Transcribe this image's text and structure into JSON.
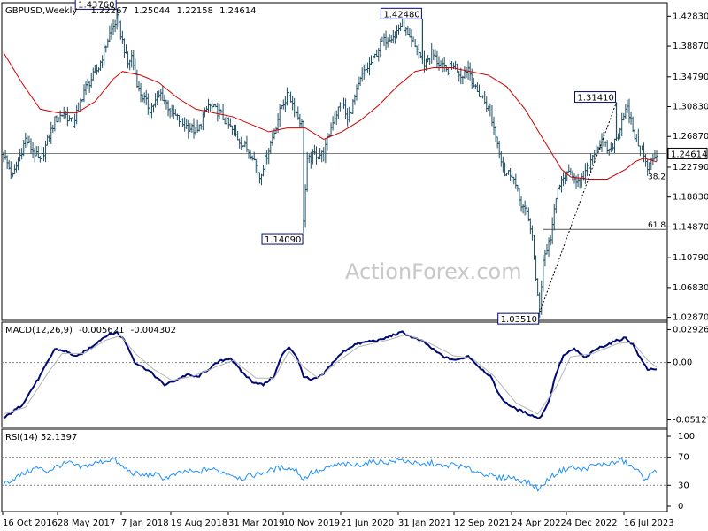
{
  "chart_data": [
    {
      "type": "bar",
      "panel": "price",
      "header": "GBPUSD,Weekly",
      "ohlc_readout": [
        "1.22267",
        "1.25044",
        "1.22158",
        "1.24614"
      ],
      "ylim": [
        1.0247,
        1.4463
      ],
      "yticks": [
        "1.42830",
        "1.38870",
        "1.34790",
        "1.30830",
        "1.26870",
        "1.22790",
        "1.18830",
        "1.14870",
        "1.10790",
        "1.06830",
        "1.02870"
      ],
      "current_price": 1.24614,
      "current_price_label": "1.24614",
      "xticks": [
        "16 Oct 2016",
        "28 May 2017",
        "7 Jan 2018",
        "19 Aug 2018",
        "31 Mar 2019",
        "10 Nov 2019",
        "21 Jun 2020",
        "31 Jan 2021",
        "12 Sep 2021",
        "24 Apr 2022",
        "4 Dec 2022",
        "16 Jul 2023"
      ],
      "close_path": [
        [
          0,
          1.245
        ],
        [
          5,
          1.215
        ],
        [
          12,
          1.265
        ],
        [
          20,
          1.235
        ],
        [
          28,
          1.29
        ],
        [
          33,
          1.3
        ],
        [
          38,
          1.285
        ],
        [
          44,
          1.33
        ],
        [
          52,
          1.36
        ],
        [
          58,
          1.405
        ],
        [
          62,
          1.425
        ],
        [
          65,
          1.395
        ],
        [
          68,
          1.365
        ],
        [
          70,
          1.375
        ],
        [
          74,
          1.33
        ],
        [
          80,
          1.305
        ],
        [
          86,
          1.325
        ],
        [
          92,
          1.3
        ],
        [
          98,
          1.285
        ],
        [
          106,
          1.275
        ],
        [
          112,
          1.31
        ],
        [
          118,
          1.3
        ],
        [
          124,
          1.28
        ],
        [
          130,
          1.26
        ],
        [
          136,
          1.245
        ],
        [
          140,
          1.215
        ],
        [
          144,
          1.245
        ],
        [
          148,
          1.275
        ],
        [
          152,
          1.31
        ],
        [
          156,
          1.325
        ],
        [
          160,
          1.3
        ],
        [
          163,
          1.285
        ],
        [
          164,
          1.16
        ],
        [
          166,
          1.235
        ],
        [
          170,
          1.245
        ],
        [
          175,
          1.245
        ],
        [
          180,
          1.29
        ],
        [
          185,
          1.315
        ],
        [
          188,
          1.29
        ],
        [
          192,
          1.32
        ],
        [
          196,
          1.35
        ],
        [
          202,
          1.37
        ],
        [
          206,
          1.39
        ],
        [
          210,
          1.4
        ],
        [
          214,
          1.405
        ],
        [
          218,
          1.42
        ],
        [
          222,
          1.395
        ],
        [
          226,
          1.385
        ],
        [
          230,
          1.365
        ],
        [
          234,
          1.38
        ],
        [
          238,
          1.365
        ],
        [
          242,
          1.355
        ],
        [
          246,
          1.365
        ],
        [
          250,
          1.35
        ],
        [
          254,
          1.36
        ],
        [
          258,
          1.33
        ],
        [
          262,
          1.32
        ],
        [
          266,
          1.3
        ],
        [
          270,
          1.26
        ],
        [
          274,
          1.22
        ],
        [
          278,
          1.22
        ],
        [
          282,
          1.185
        ],
        [
          286,
          1.165
        ],
        [
          289,
          1.14
        ],
        [
          291,
          1.075
        ],
        [
          293,
          1.04
        ],
        [
          295,
          1.105
        ],
        [
          299,
          1.135
        ],
        [
          303,
          1.2
        ],
        [
          307,
          1.215
        ],
        [
          311,
          1.22
        ],
        [
          315,
          1.205
        ],
        [
          319,
          1.225
        ],
        [
          323,
          1.25
        ],
        [
          327,
          1.26
        ],
        [
          331,
          1.25
        ],
        [
          335,
          1.265
        ],
        [
          339,
          1.3
        ],
        [
          341,
          1.305
        ],
        [
          345,
          1.27
        ],
        [
          349,
          1.25
        ],
        [
          352,
          1.225
        ],
        [
          355,
          1.24
        ],
        [
          357,
          1.24614
        ]
      ],
      "sma": [
        [
          0,
          1.38
        ],
        [
          10,
          1.34
        ],
        [
          20,
          1.305
        ],
        [
          30,
          1.3
        ],
        [
          40,
          1.3
        ],
        [
          50,
          1.315
        ],
        [
          60,
          1.345
        ],
        [
          65,
          1.355
        ],
        [
          75,
          1.35
        ],
        [
          85,
          1.34
        ],
        [
          95,
          1.32
        ],
        [
          105,
          1.305
        ],
        [
          115,
          1.3
        ],
        [
          125,
          1.295
        ],
        [
          135,
          1.285
        ],
        [
          145,
          1.275
        ],
        [
          155,
          1.28
        ],
        [
          165,
          1.28
        ],
        [
          175,
          1.265
        ],
        [
          185,
          1.275
        ],
        [
          195,
          1.29
        ],
        [
          205,
          1.31
        ],
        [
          215,
          1.335
        ],
        [
          225,
          1.355
        ],
        [
          235,
          1.36
        ],
        [
          245,
          1.36
        ],
        [
          255,
          1.355
        ],
        [
          265,
          1.35
        ],
        [
          275,
          1.335
        ],
        [
          285,
          1.305
        ],
        [
          295,
          1.265
        ],
        [
          300,
          1.245
        ],
        [
          305,
          1.225
        ],
        [
          310,
          1.215
        ],
        [
          320,
          1.212
        ],
        [
          330,
          1.212
        ],
        [
          340,
          1.225
        ],
        [
          345,
          1.235
        ],
        [
          350,
          1.24
        ],
        [
          357,
          1.235
        ]
      ],
      "annotations": [
        {
          "label": "1.43760",
          "x": 62,
          "price": 1.4376
        },
        {
          "label": "1.42480",
          "x": 229,
          "price": 1.4248
        },
        {
          "label": "1.14090",
          "x": 164,
          "price": 1.1409
        },
        {
          "label": "1.03510",
          "x": 293,
          "price": 1.0351
        },
        {
          "label": "1.31410",
          "x": 335,
          "price": 1.3141
        }
      ],
      "fib_levels": [
        {
          "label": "38.2",
          "price": 1.2097,
          "from_x": 293
        },
        {
          "label": "61.8",
          "price": 1.1454,
          "from_x": 294
        }
      ],
      "trendline": [
        [
          293,
          1.0351
        ],
        [
          335,
          1.3141
        ]
      ],
      "watermark": "ActionForex.com"
    },
    {
      "type": "line",
      "panel": "macd",
      "header": "MACD(12,26,9)",
      "header_values": [
        "-0.005621",
        "-0.004302"
      ],
      "ylim": [
        -0.058,
        0.036
      ],
      "yticks": [
        "0.029261",
        "0.00",
        "-0.051279"
      ],
      "series": [
        {
          "role": "macd",
          "points": [
            [
              0,
              -0.05
            ],
            [
              10,
              -0.038
            ],
            [
              20,
              -0.012
            ],
            [
              28,
              0.012
            ],
            [
              34,
              0.01
            ],
            [
              40,
              0.005
            ],
            [
              48,
              0.014
            ],
            [
              56,
              0.024
            ],
            [
              62,
              0.027
            ],
            [
              66,
              0.02
            ],
            [
              72,
              0.0
            ],
            [
              80,
              -0.008
            ],
            [
              88,
              -0.02
            ],
            [
              94,
              -0.016
            ],
            [
              100,
              -0.011
            ],
            [
              106,
              -0.013
            ],
            [
              112,
              -0.006
            ],
            [
              118,
              0.001
            ],
            [
              124,
              0.004
            ],
            [
              130,
              -0.008
            ],
            [
              136,
              -0.017
            ],
            [
              142,
              -0.02
            ],
            [
              148,
              -0.012
            ],
            [
              152,
              0.006
            ],
            [
              156,
              0.014
            ],
            [
              160,
              0.006
            ],
            [
              164,
              -0.012
            ],
            [
              168,
              -0.016
            ],
            [
              174,
              -0.012
            ],
            [
              180,
              0.0
            ],
            [
              186,
              0.01
            ],
            [
              192,
              0.016
            ],
            [
              200,
              0.019
            ],
            [
              206,
              0.02
            ],
            [
              212,
              0.024
            ],
            [
              218,
              0.027
            ],
            [
              224,
              0.022
            ],
            [
              230,
              0.018
            ],
            [
              236,
              0.01
            ],
            [
              242,
              0.004
            ],
            [
              248,
              0.002
            ],
            [
              254,
              0.006
            ],
            [
              260,
              -0.004
            ],
            [
              266,
              -0.012
            ],
            [
              272,
              -0.032
            ],
            [
              278,
              -0.04
            ],
            [
              284,
              -0.044
            ],
            [
              290,
              -0.048
            ],
            [
              293,
              -0.05
            ],
            [
              298,
              -0.035
            ],
            [
              302,
              -0.01
            ],
            [
              306,
              0.006
            ],
            [
              312,
              0.012
            ],
            [
              318,
              0.004
            ],
            [
              324,
              0.012
            ],
            [
              330,
              0.016
            ],
            [
              336,
              0.02
            ],
            [
              340,
              0.022
            ],
            [
              344,
              0.016
            ],
            [
              348,
              0.004
            ],
            [
              352,
              -0.006
            ],
            [
              357,
              -0.005621
            ]
          ]
        },
        {
          "role": "signal",
          "points": [
            [
              0,
              -0.046
            ],
            [
              12,
              -0.04
            ],
            [
              24,
              -0.01
            ],
            [
              32,
              0.008
            ],
            [
              44,
              0.008
            ],
            [
              56,
              0.02
            ],
            [
              64,
              0.024
            ],
            [
              72,
              0.008
            ],
            [
              82,
              -0.006
            ],
            [
              92,
              -0.016
            ],
            [
              104,
              -0.012
            ],
            [
              116,
              -0.004
            ],
            [
              126,
              0.002
            ],
            [
              138,
              -0.014
            ],
            [
              148,
              -0.014
            ],
            [
              156,
              0.01
            ],
            [
              164,
              -0.004
            ],
            [
              172,
              -0.014
            ],
            [
              182,
              0.0
            ],
            [
              194,
              0.014
            ],
            [
              210,
              0.02
            ],
            [
              220,
              0.025
            ],
            [
              232,
              0.018
            ],
            [
              246,
              0.006
            ],
            [
              256,
              0.004
            ],
            [
              268,
              -0.012
            ],
            [
              280,
              -0.036
            ],
            [
              292,
              -0.046
            ],
            [
              302,
              -0.022
            ],
            [
              310,
              0.005
            ],
            [
              322,
              0.008
            ],
            [
              336,
              0.017
            ],
            [
              344,
              0.018
            ],
            [
              352,
              0.002
            ],
            [
              357,
              -0.004302
            ]
          ]
        }
      ]
    },
    {
      "type": "line",
      "panel": "rsi",
      "header": "RSI(14) 52.1397",
      "ylim": [
        0,
        100
      ],
      "yticks": [
        "100",
        "70",
        "30",
        "0"
      ],
      "series": [
        {
          "role": "rsi",
          "points": [
            [
              0,
              32
            ],
            [
              6,
              40
            ],
            [
              12,
              48
            ],
            [
              18,
              55
            ],
            [
              24,
              50
            ],
            [
              30,
              58
            ],
            [
              36,
              62
            ],
            [
              42,
              55
            ],
            [
              48,
              60
            ],
            [
              54,
              64
            ],
            [
              60,
              68
            ],
            [
              64,
              58
            ],
            [
              70,
              48
            ],
            [
              76,
              44
            ],
            [
              82,
              46
            ],
            [
              88,
              40
            ],
            [
              94,
              45
            ],
            [
              100,
              50
            ],
            [
              106,
              48
            ],
            [
              112,
              54
            ],
            [
              118,
              50
            ],
            [
              124,
              46
            ],
            [
              130,
              40
            ],
            [
              136,
              44
            ],
            [
              142,
              48
            ],
            [
              148,
              53
            ],
            [
              154,
              56
            ],
            [
              160,
              52
            ],
            [
              164,
              38
            ],
            [
              168,
              48
            ],
            [
              174,
              50
            ],
            [
              180,
              58
            ],
            [
              186,
              60
            ],
            [
              192,
              58
            ],
            [
              198,
              62
            ],
            [
              204,
              64
            ],
            [
              210,
              63
            ],
            [
              216,
              66
            ],
            [
              222,
              64
            ],
            [
              228,
              58
            ],
            [
              234,
              62
            ],
            [
              240,
              56
            ],
            [
              246,
              60
            ],
            [
              252,
              55
            ],
            [
              258,
              50
            ],
            [
              264,
              46
            ],
            [
              270,
              40
            ],
            [
              276,
              42
            ],
            [
              282,
              38
            ],
            [
              288,
              32
            ],
            [
              293,
              24
            ],
            [
              298,
              40
            ],
            [
              304,
              50
            ],
            [
              310,
              56
            ],
            [
              316,
              52
            ],
            [
              322,
              58
            ],
            [
              328,
              60
            ],
            [
              334,
              62
            ],
            [
              338,
              66
            ],
            [
              342,
              58
            ],
            [
              346,
              52
            ],
            [
              350,
              40
            ],
            [
              354,
              44
            ],
            [
              357,
              52.1397
            ]
          ]
        }
      ]
    }
  ],
  "colors": {
    "bars": "#1f4f62",
    "sma": "#d00000",
    "macd": "#000a73",
    "signal": "#b4b4b4",
    "rsi": "#1e90ff",
    "grid": "#7f7f7f",
    "fib": "#555555",
    "watermark": "#c8c8c8"
  }
}
